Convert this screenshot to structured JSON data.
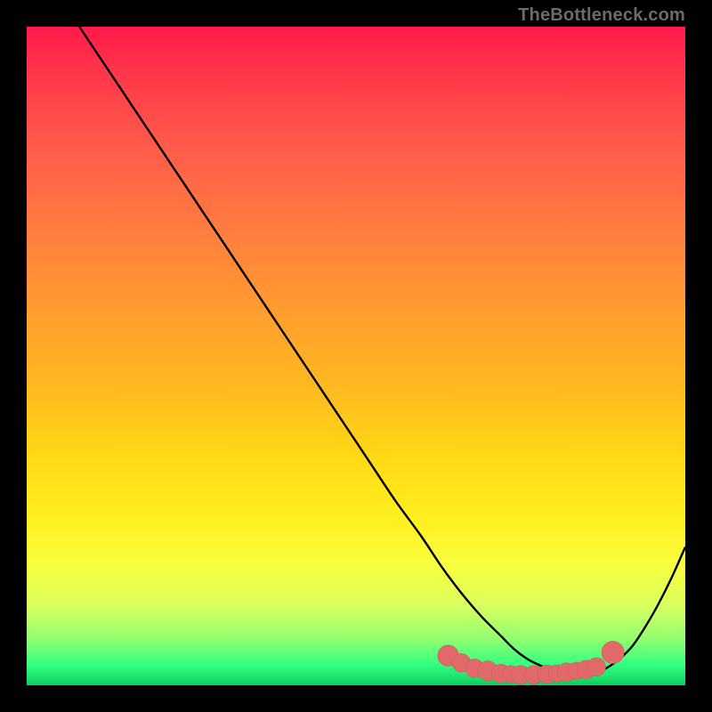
{
  "watermark": "TheBottleneck.com",
  "colors": {
    "frame": "#000000",
    "curve": "#000000",
    "marker_fill": "#e06a6a",
    "marker_stroke": "#d85858"
  },
  "chart_data": {
    "type": "line",
    "title": "",
    "xlabel": "",
    "ylabel": "",
    "xlim": [
      0,
      100
    ],
    "ylim": [
      0,
      100
    ],
    "grid": false,
    "legend": false,
    "series": [
      {
        "name": "bottleneck",
        "x": [
          8,
          12,
          16,
          20,
          24,
          28,
          32,
          36,
          40,
          44,
          48,
          52,
          56,
          60,
          63,
          66,
          69,
          72,
          74,
          76,
          78,
          80,
          82,
          84,
          86,
          88,
          90,
          92,
          94,
          96,
          98,
          100
        ],
        "y": [
          100,
          94,
          88,
          82,
          76,
          70,
          64,
          58,
          52,
          46,
          40,
          34,
          28,
          22.5,
          18,
          14,
          10.5,
          7.5,
          5.5,
          4,
          3,
          2.2,
          1.8,
          1.6,
          1.8,
          2.6,
          4,
          6,
          9,
          12.5,
          16.5,
          21
        ]
      }
    ],
    "markers": [
      {
        "x": 64,
        "y": 4.5,
        "r": 1.6
      },
      {
        "x": 66,
        "y": 3.4,
        "r": 1.4
      },
      {
        "x": 68,
        "y": 2.6,
        "r": 1.4
      },
      {
        "x": 70,
        "y": 2.2,
        "r": 1.5
      },
      {
        "x": 72,
        "y": 1.8,
        "r": 1.4
      },
      {
        "x": 73.5,
        "y": 1.7,
        "r": 1.3
      },
      {
        "x": 75,
        "y": 1.6,
        "r": 1.4
      },
      {
        "x": 77,
        "y": 1.6,
        "r": 1.4
      },
      {
        "x": 79,
        "y": 1.7,
        "r": 1.4
      },
      {
        "x": 80.5,
        "y": 1.8,
        "r": 1.3
      },
      {
        "x": 82,
        "y": 2.0,
        "r": 1.4
      },
      {
        "x": 83.5,
        "y": 2.2,
        "r": 1.3
      },
      {
        "x": 85,
        "y": 2.4,
        "r": 1.4
      },
      {
        "x": 86.5,
        "y": 2.8,
        "r": 1.4
      },
      {
        "x": 89,
        "y": 5.0,
        "r": 1.7
      }
    ]
  }
}
